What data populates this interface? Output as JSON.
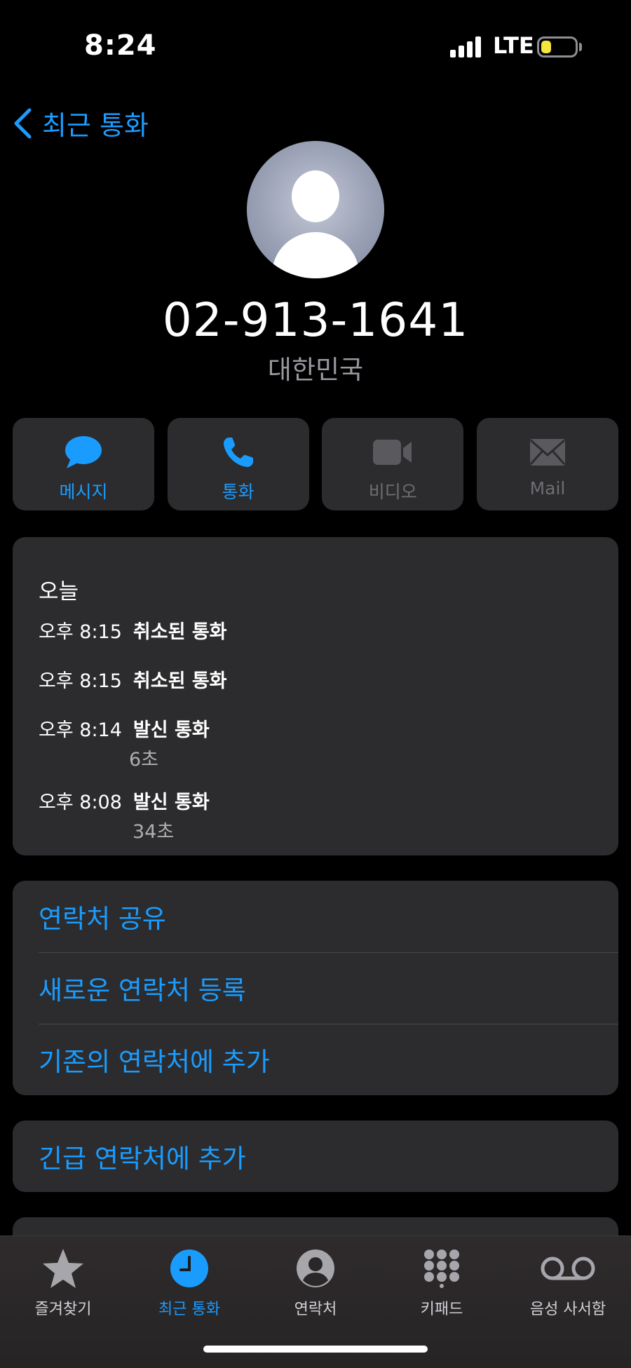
{
  "status": {
    "time": "8:24",
    "network": "LTE",
    "battery_level": 0.3
  },
  "nav": {
    "back_label": "최근 통화"
  },
  "contact": {
    "phone": "02-913-1641",
    "country": "대한민국"
  },
  "actions": [
    {
      "label": "메시지",
      "icon": "message-bubble-icon",
      "enabled": true
    },
    {
      "label": "통화",
      "icon": "phone-icon",
      "enabled": true
    },
    {
      "label": "비디오",
      "icon": "video-camera-icon",
      "enabled": false
    },
    {
      "label": "Mail",
      "icon": "envelope-icon",
      "enabled": false
    }
  ],
  "history": {
    "day": "오늘",
    "calls": [
      {
        "time": "오후 8:15",
        "type": "취소된 통화",
        "duration": ""
      },
      {
        "time": "오후 8:15",
        "type": "취소된 통화",
        "duration": ""
      },
      {
        "time": "오후 8:14",
        "type": "발신 통화",
        "duration": "6초"
      },
      {
        "time": "오후 8:08",
        "type": "발신 통화",
        "duration": "34초"
      }
    ]
  },
  "contact_actions": [
    "연락처 공유",
    "새로운 연락처 등록",
    "기존의 연락처에 추가"
  ],
  "emergency_action": "긴급 연락처에 추가",
  "tabs": [
    {
      "label": "즐겨찾기",
      "icon": "star-icon",
      "active": false
    },
    {
      "label": "최근 통화",
      "icon": "clock-icon",
      "active": true
    },
    {
      "label": "연락처",
      "icon": "person-circle-icon",
      "active": false
    },
    {
      "label": "키패드",
      "icon": "keypad-icon",
      "active": false
    },
    {
      "label": "음성 사서함",
      "icon": "voicemail-icon",
      "active": false
    }
  ],
  "colors": {
    "accent": "#1a9cff",
    "card": "#2c2c2e",
    "background": "#000000",
    "battery": "#f7e43c"
  }
}
